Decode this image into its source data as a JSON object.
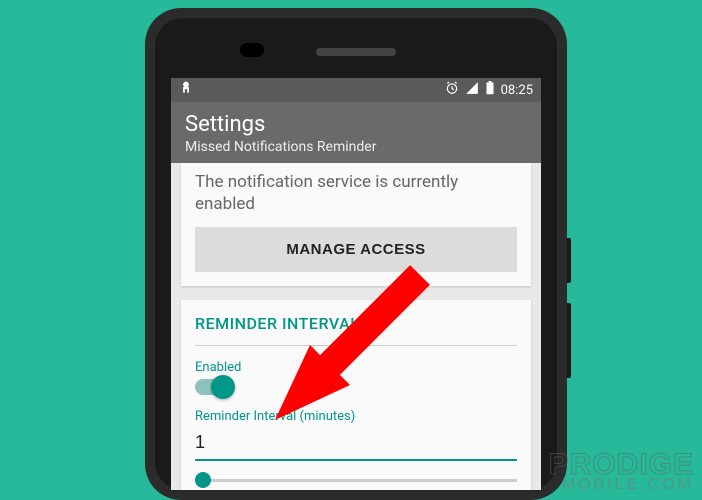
{
  "status_bar": {
    "time": "08:25",
    "icons": {
      "alarm": "⏰",
      "signal": "▲",
      "battery": "▮"
    }
  },
  "app_bar": {
    "title": "Settings",
    "subtitle": "Missed Notifications Reminder"
  },
  "service_card": {
    "text": "The notification service is currently enabled",
    "button_label": "MANAGE ACCESS"
  },
  "reminder_section": {
    "title": "REMINDER INTERVAL",
    "enabled_label": "Enabled",
    "interval_label": "Reminder Interval (minutes)",
    "interval_value": "1"
  },
  "watermark": {
    "line1": "PRODIGE",
    "line2": "MOBILE.COM"
  },
  "colors": {
    "accent": "#009688",
    "background": "#26b99a"
  }
}
